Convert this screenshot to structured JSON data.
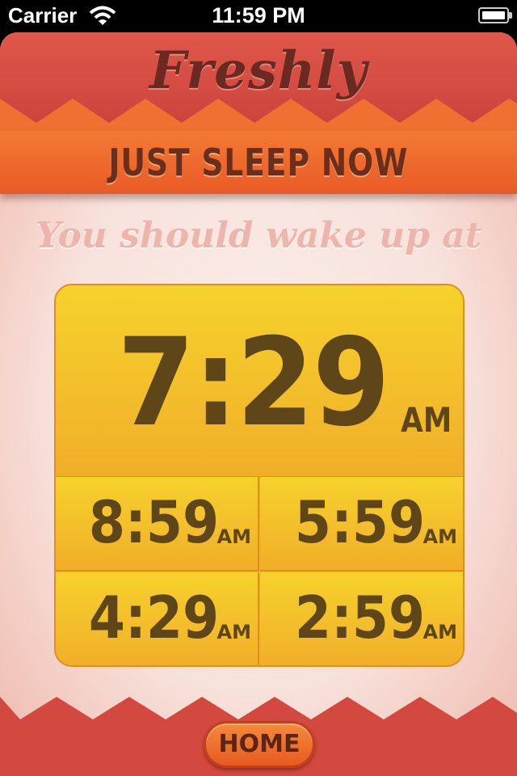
{
  "status_bar": {
    "carrier": "Carrier",
    "time": "11:59 PM",
    "icons": [
      "wifi-icon",
      "battery-icon"
    ]
  },
  "header": {
    "logo": "Freshly",
    "title_button": "JUST SLEEP NOW"
  },
  "subtitle": "You should wake up at",
  "times": {
    "main": {
      "time": "7:29",
      "ampm": "AM"
    },
    "options": [
      {
        "time": "8:59",
        "ampm": "AM"
      },
      {
        "time": "5:59",
        "ampm": "AM"
      },
      {
        "time": "4:29",
        "ampm": "AM"
      },
      {
        "time": "2:59",
        "ampm": "AM"
      }
    ]
  },
  "footer": {
    "home_button": "HOME"
  },
  "colors": {
    "header_red": "#d4493f",
    "header_orange": "#ee6a2d",
    "card_yellow": "#f3c22b",
    "text_brown": "#5f4618",
    "subtitle_pink": "#eeb5ad"
  }
}
